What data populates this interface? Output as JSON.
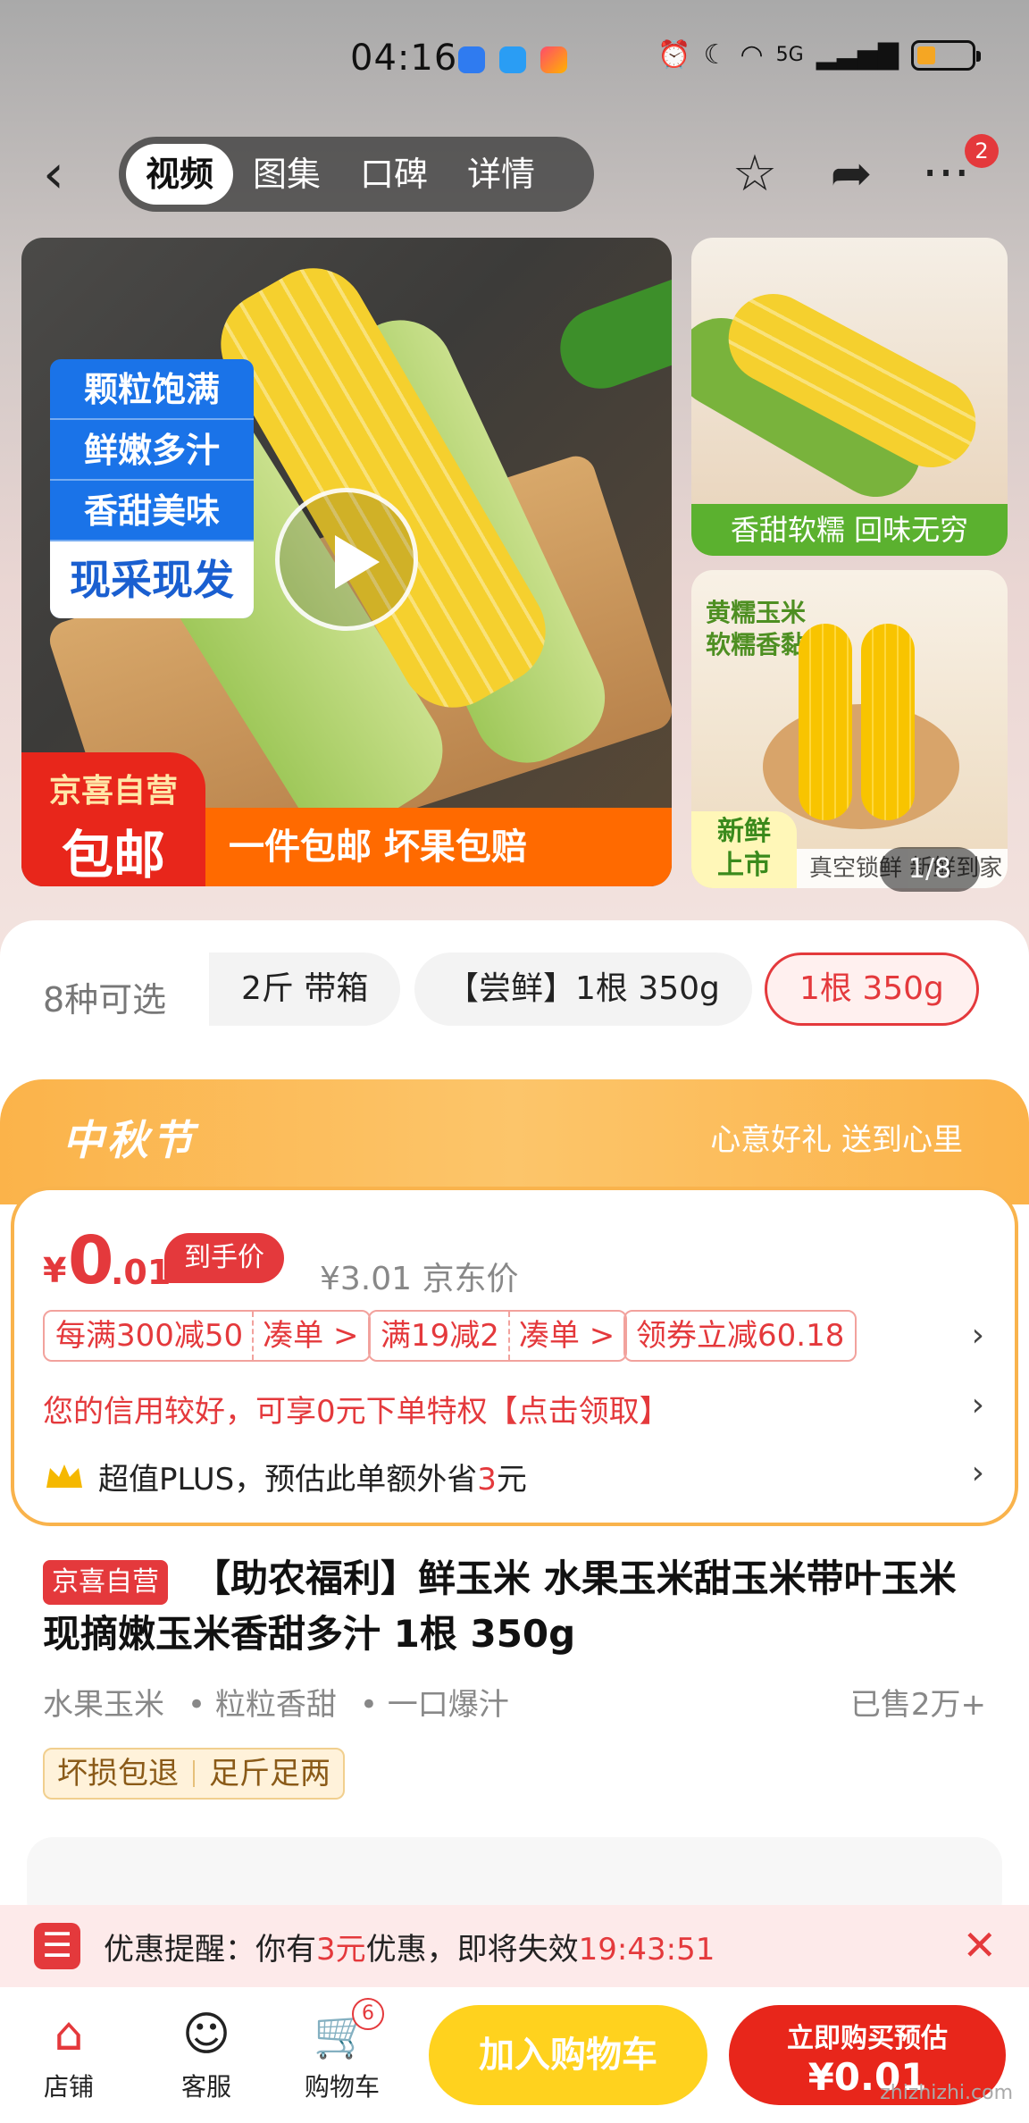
{
  "status_bar": {
    "time": "04:16",
    "network": "5G",
    "battery_level": 0.35
  },
  "header": {
    "tabs": [
      "视频",
      "图集",
      "口碑",
      "详情"
    ],
    "active_tab": 0,
    "cart_badge": "2",
    "icons": [
      "back-icon",
      "star-icon",
      "share-icon",
      "more-icon"
    ]
  },
  "gallery": {
    "main_labels": [
      "颗粒饱满",
      "鲜嫩多汁",
      "香甜美味"
    ],
    "main_cta": "现采现发",
    "badge_line1": "京喜自营",
    "badge_line2": "包邮",
    "banner": "一件包邮 坏果包赔",
    "side1_caption": "香甜软糯 回味无穷",
    "side2_label_1": "黄糯玉米",
    "side2_label_2": "软糯香黏",
    "side2_new_1": "新鲜",
    "side2_new_2": "上市",
    "side2_bottom": "真空锁鲜 新鲜到家",
    "counter": "1/8"
  },
  "variants": {
    "label": "8种可选",
    "options": [
      "2斤 带箱",
      "【尝鲜】1根 350g",
      "1根 350g"
    ],
    "selected": 2
  },
  "festival": {
    "title": "中秋节",
    "subtitle": "心意好礼 送到心里"
  },
  "price": {
    "currency": "¥",
    "integer": "0",
    "decimal": ".01",
    "tag": "到手价",
    "original": "¥3.01 京东价",
    "coupons": [
      {
        "text": "每满300减50",
        "action": "凑单 >"
      },
      {
        "text": "满19减2",
        "action": "凑单 >"
      },
      {
        "text": "领券立减60.18",
        "action": ""
      }
    ],
    "credit": "您的信用较好，可享0元下单特权【点击领取】",
    "plus_prefix": "超值PLUS，预估此单额外省",
    "plus_amount": "3",
    "plus_suffix": "元"
  },
  "product": {
    "badge": "京喜自营",
    "title": "【助农福利】鲜玉米 水果玉米甜玉米带叶玉米现摘嫩玉米香甜多汁 1根 350g",
    "features": [
      "水果玉米",
      "• 粒粒香甜",
      "• 一口爆汁"
    ],
    "sold": "已售2万+",
    "guarantees": [
      "坏损包退",
      "足斤足两"
    ]
  },
  "promo": {
    "prefix": "优惠提醒：你有",
    "amount": "3元",
    "middle": "优惠，即将失效",
    "countdown": "19:43:51"
  },
  "bottom_bar": {
    "store": "店铺",
    "service": "客服",
    "cart": "购物车",
    "cart_count": "6",
    "add_to_cart": "加入购物车",
    "buy_line1": "立即购买预估",
    "buy_line2": "¥0.01"
  },
  "watermark": "zhizhizhi.com",
  "colors": {
    "accent_red": "#e4393c",
    "cart_yellow": "#ffd21e",
    "festival_orange": "#fbb34a"
  }
}
